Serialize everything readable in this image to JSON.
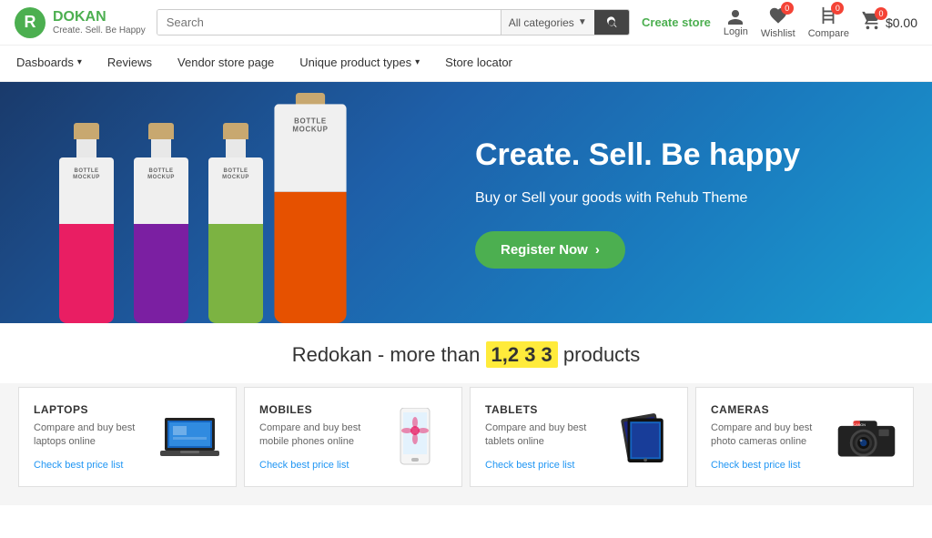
{
  "header": {
    "logo": {
      "letter": "R",
      "brand": "DOKAN",
      "tagline": "Create. Sell. Be Happy"
    },
    "search": {
      "placeholder": "Search",
      "category": "All categories"
    },
    "create_store": "Create store",
    "actions": {
      "login": "Login",
      "wishlist": "Wishlist",
      "compare": "Compare",
      "wishlist_count": "0",
      "compare_count": "0",
      "cart_count": "0",
      "cart_price": "$0.00"
    }
  },
  "nav": {
    "items": [
      {
        "label": "Dasboards",
        "has_dropdown": true
      },
      {
        "label": "Reviews",
        "has_dropdown": false
      },
      {
        "label": "Vendor store page",
        "has_dropdown": false
      },
      {
        "label": "Unique product types",
        "has_dropdown": true
      },
      {
        "label": "Store locator",
        "has_dropdown": false
      }
    ]
  },
  "hero": {
    "title": "Create. Sell. Be happy",
    "subtitle": "Buy or Sell your goods with\nRehub Theme",
    "register_btn": "Register Now",
    "bottles": [
      {
        "color": "pink",
        "label": "BOTTLE\nMOCKUP"
      },
      {
        "color": "purple",
        "label": "BOTTLE\nMOCKUP"
      },
      {
        "color": "green",
        "label": "BOTTLE\nMOCKUP"
      },
      {
        "color": "orange",
        "label": "BOTTLE\nMOCKUP"
      }
    ]
  },
  "products_count": {
    "prefix": "Redokan - more than",
    "count": "1,2 3 3",
    "suffix": "products"
  },
  "categories": [
    {
      "id": "laptops",
      "title": "LAPTOPS",
      "description": "Compare and buy best laptops online",
      "link": "Check best price list"
    },
    {
      "id": "mobiles",
      "title": "MOBILES",
      "description": "Compare and buy best mobile phones online",
      "link": "Check best price list"
    },
    {
      "id": "tablets",
      "title": "TABLETS",
      "description": "Compare and buy best tablets online",
      "link": "Check best price list"
    },
    {
      "id": "cameras",
      "title": "CAMERAS",
      "description": "Compare and buy best photo cameras online",
      "link": "Check best price list"
    }
  ]
}
